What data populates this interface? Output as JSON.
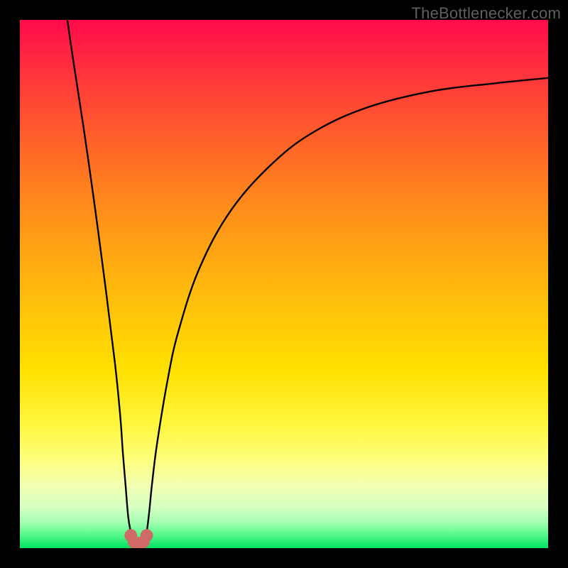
{
  "watermark": "TheBottlenecker.com",
  "colors": {
    "frame_background": "#000000",
    "curve_stroke": "#000000",
    "marker_fill": "#cf6a67",
    "watermark_text": "#5f5f5f"
  },
  "chart_data": {
    "type": "line",
    "title": "",
    "xlabel": "",
    "ylabel": "",
    "xlim": [
      0,
      100
    ],
    "ylim": [
      0,
      100
    ],
    "series": [
      {
        "name": "left-branch",
        "x": [
          9,
          10,
          12,
          14,
          16,
          18,
          19,
          19.5,
          20,
          20.5,
          21,
          21.5
        ],
        "y": [
          100,
          93,
          80,
          66,
          51,
          35,
          25,
          18,
          12,
          6,
          3,
          1
        ]
      },
      {
        "name": "right-branch",
        "x": [
          23.5,
          24,
          24.5,
          25,
          26,
          28,
          30,
          34,
          40,
          48,
          56,
          66,
          78,
          90,
          100
        ],
        "y": [
          1,
          3,
          7,
          12,
          20,
          32,
          41,
          53,
          64,
          73,
          79,
          83.5,
          86.5,
          88,
          89
        ]
      }
    ],
    "markers": {
      "name": "minimum-cluster",
      "points": [
        {
          "x": 21.0,
          "y": 2.4
        },
        {
          "x": 21.6,
          "y": 1.2
        },
        {
          "x": 22.2,
          "y": 0.9
        },
        {
          "x": 22.8,
          "y": 0.9
        },
        {
          "x": 23.4,
          "y": 1.2
        },
        {
          "x": 24.0,
          "y": 2.4
        }
      ],
      "radius_pct": 1.2
    },
    "grid": false,
    "legend": false
  }
}
